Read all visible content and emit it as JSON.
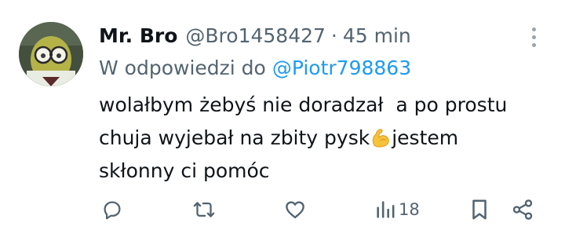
{
  "tweet": {
    "author_name": "Mr. Bro",
    "handle": "@Bro1458427",
    "separator": "·",
    "time": "45 min",
    "reply_prefix": "W odpowiedzi do",
    "reply_to": "@Piotr798863",
    "text_line1": "wolałbym żebyś nie doradzał  a po prostu",
    "text_line2a": "chuja wyjebał na zbity pysk",
    "emoji": "flexed-biceps",
    "text_line2b": "jestem",
    "text_line3": "skłonny ci pomóc"
  },
  "actions": {
    "views_count": "18"
  },
  "colors": {
    "text": "#0f1419",
    "secondary": "#536471",
    "link": "#1d9bf0",
    "icon": "#536471"
  },
  "icons": [
    "more-icon",
    "reply-icon",
    "retweet-icon",
    "like-icon",
    "views-icon",
    "bookmark-icon",
    "share-icon"
  ]
}
